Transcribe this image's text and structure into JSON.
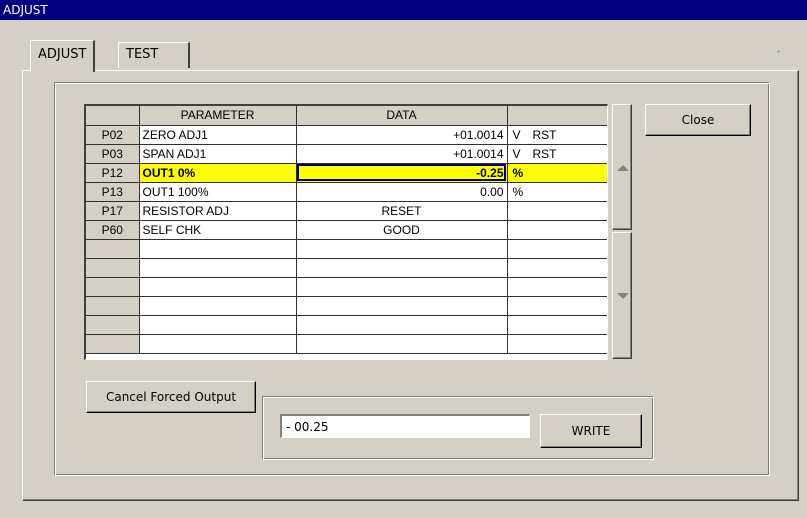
{
  "window": {
    "title": "ADJUST"
  },
  "tabs": [
    {
      "label": "ADJUST",
      "active": true
    },
    {
      "label": "TEST",
      "active": false
    }
  ],
  "grid": {
    "columns": [
      "PARAMETER",
      "DATA"
    ],
    "rows": [
      {
        "id": "P02",
        "param": "ZERO ADJ1",
        "value": "+01.0014",
        "unit": "V",
        "extra": "RST",
        "highlight": false
      },
      {
        "id": "P03",
        "param": "SPAN ADJ1",
        "value": "+01.0014",
        "unit": "V",
        "extra": "RST",
        "highlight": false
      },
      {
        "id": "P12",
        "param": "OUT1 0%",
        "value": "-0.25",
        "unit": "%",
        "extra": "",
        "highlight": true
      },
      {
        "id": "P13",
        "param": "OUT1 100%",
        "value": "0.00",
        "unit": "%",
        "extra": "",
        "highlight": false
      },
      {
        "id": "P17",
        "param": "RESISTOR ADJ",
        "value": "RESET",
        "unit": "",
        "extra": "",
        "highlight": false
      },
      {
        "id": "P60",
        "param": "SELF CHK",
        "value": "GOOD",
        "unit": "",
        "extra": "",
        "highlight": false
      }
    ],
    "empty_rows": 6
  },
  "buttons": {
    "close": "Close",
    "cancel_forced_output": "Cancel Forced Output",
    "write": "WRITE"
  },
  "write_input": {
    "value": "-  00.25"
  },
  "colors": {
    "title_bar": "#000080",
    "highlight": "#ffff00",
    "face": "#d4d0c8"
  }
}
